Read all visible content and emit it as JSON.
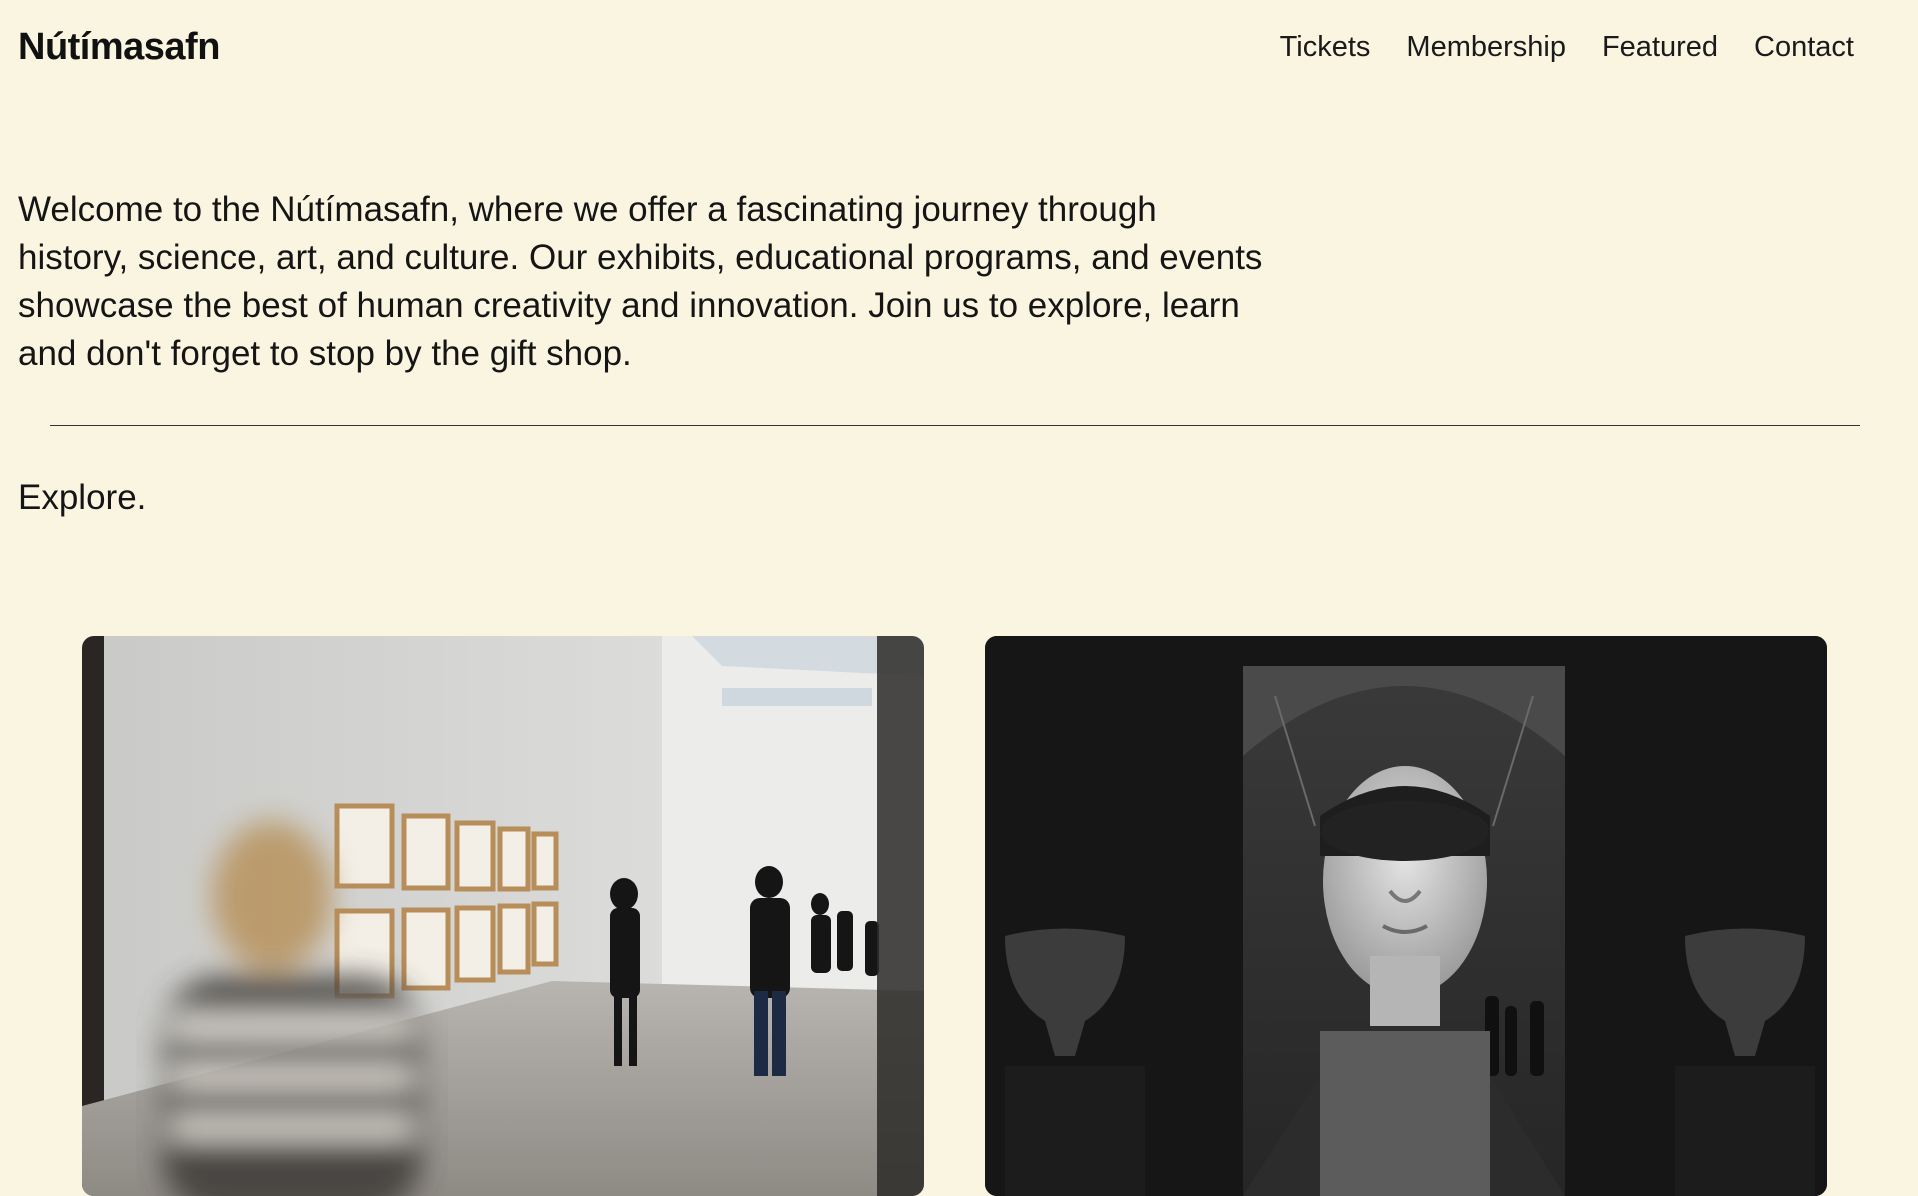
{
  "header": {
    "brand": "Nútímasafn",
    "nav": [
      {
        "label": "Tickets"
      },
      {
        "label": "Membership"
      },
      {
        "label": "Featured"
      },
      {
        "label": "Contact"
      }
    ]
  },
  "intro": {
    "text": "Welcome to the Nútímasafn, where we offer a fascinating journey through history, science, art, and culture. Our exhibits, educational programs, and events showcase the best of human creativity and innovation. Join us to explore, learn and don't forget to stop by the gift shop."
  },
  "explore": {
    "heading": "Explore."
  },
  "colors": {
    "background": "#faf5e1",
    "text": "#111111",
    "divider": "#333333"
  }
}
